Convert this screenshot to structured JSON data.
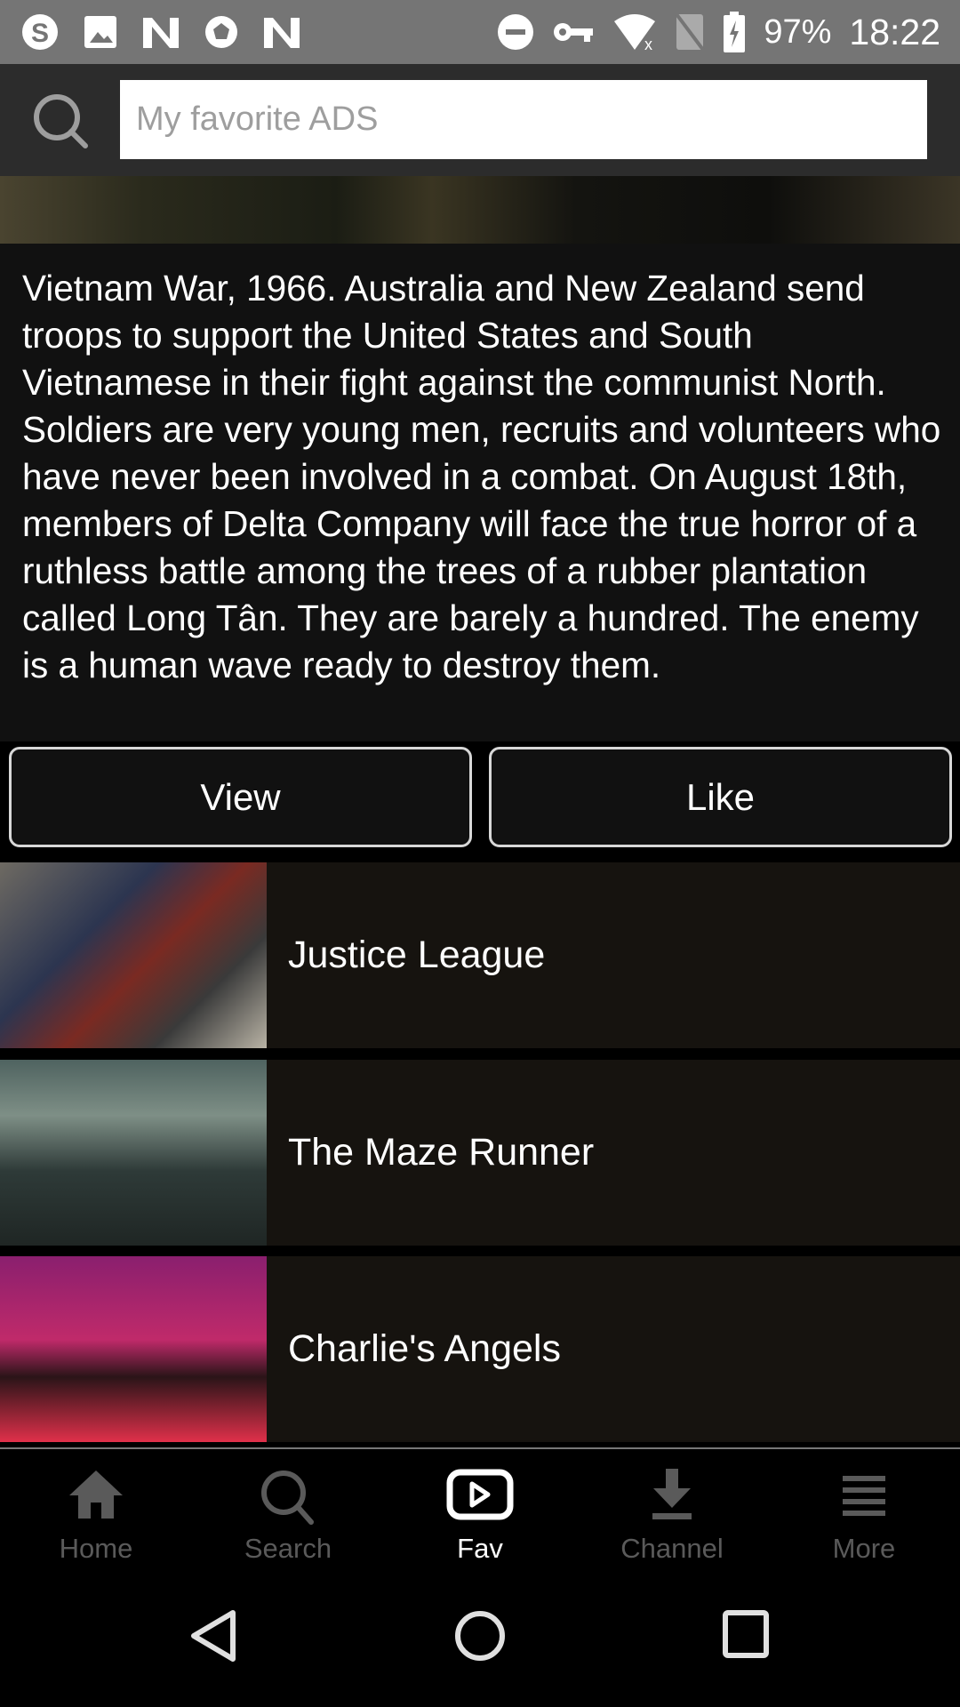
{
  "status_bar": {
    "battery": "97%",
    "time": "18:22",
    "left_icons": [
      "skype-icon",
      "image-icon",
      "n-icon",
      "soccer-icon",
      "n-icon"
    ],
    "right_icons": [
      "dnd-icon",
      "vpn-key-icon",
      "wifi-off-icon",
      "no-sim-icon",
      "battery-charging-icon"
    ]
  },
  "search": {
    "placeholder": "My favorite ADS",
    "value": ""
  },
  "description": "Vietnam War, 1966. Australia and New Zealand send troops to support the United States and South Vietnamese in their fight against the communist North. Soldiers are very young men, recruits and volunteers who have never been involved in a combat. On August 18th, members of Delta Company will face the true horror of a ruthless battle among the trees of a rubber plantation called Long Tân. They are barely a hundred. The enemy is a human wave ready to destroy them.",
  "actions": {
    "view": "View",
    "like": "Like"
  },
  "list": [
    {
      "title": "Justice League"
    },
    {
      "title": "The Maze Runner"
    },
    {
      "title": "Charlie's Angels"
    }
  ],
  "bottom_nav": [
    {
      "label": "Home",
      "icon": "home-icon"
    },
    {
      "label": "Search",
      "icon": "search-icon"
    },
    {
      "label": "Fav",
      "icon": "play-icon",
      "active": true
    },
    {
      "label": "Channel",
      "icon": "download-icon"
    },
    {
      "label": "More",
      "icon": "menu-icon"
    }
  ]
}
